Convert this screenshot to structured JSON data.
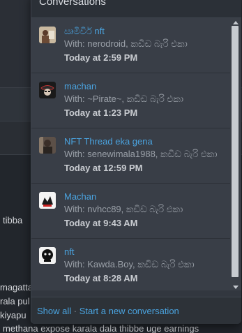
{
  "popup": {
    "title": "Conversations",
    "footer": {
      "show_all": "Show all",
      "separator": " · ",
      "start_new": "Start a new conversation"
    }
  },
  "conversations": [
    {
      "title": "ඍමිවිර් nft",
      "with_prefix": "With: ",
      "participants": "nerodroid, කඩිඩ බැරි එකා",
      "time": "Today at 2:59 PM",
      "avatar_icon": "user-avatar-photo"
    },
    {
      "title": "machan",
      "with_prefix": "With: ",
      "participants": "~Pirate~, කඩිඩ බැරි එකා",
      "time": "Today at 1:23 PM",
      "avatar_icon": "pirate-avatar"
    },
    {
      "title": "NFT Thread eka gena",
      "with_prefix": "With: ",
      "participants": "senewimala1988, කඩිඩ බැරි එකා",
      "time": "Today at 12:59 PM",
      "avatar_icon": "user-avatar-photo"
    },
    {
      "title": "Machan",
      "with_prefix": "With: ",
      "participants": "nvhcc89, කඩිඩ බැරි එකා",
      "time": "Today at 9:43 AM",
      "avatar_icon": "logo-avatar"
    },
    {
      "title": "nft",
      "with_prefix": "With: ",
      "participants": "Kawda.Boy, කඩිඩ බැරි එකා",
      "time": "Today at 8:28 AM",
      "avatar_icon": "logo-avatar"
    }
  ],
  "background_text": {
    "line1": "tibba",
    "line2": "magatta,",
    "line3": "rala pul",
    "line4": "kiyapu",
    "line5": "methana expose karala dala thibbe uge earnings"
  },
  "colors": {
    "link": "#4aa3df",
    "popup_bg": "#32373f",
    "text_muted": "#9aa0a8"
  }
}
